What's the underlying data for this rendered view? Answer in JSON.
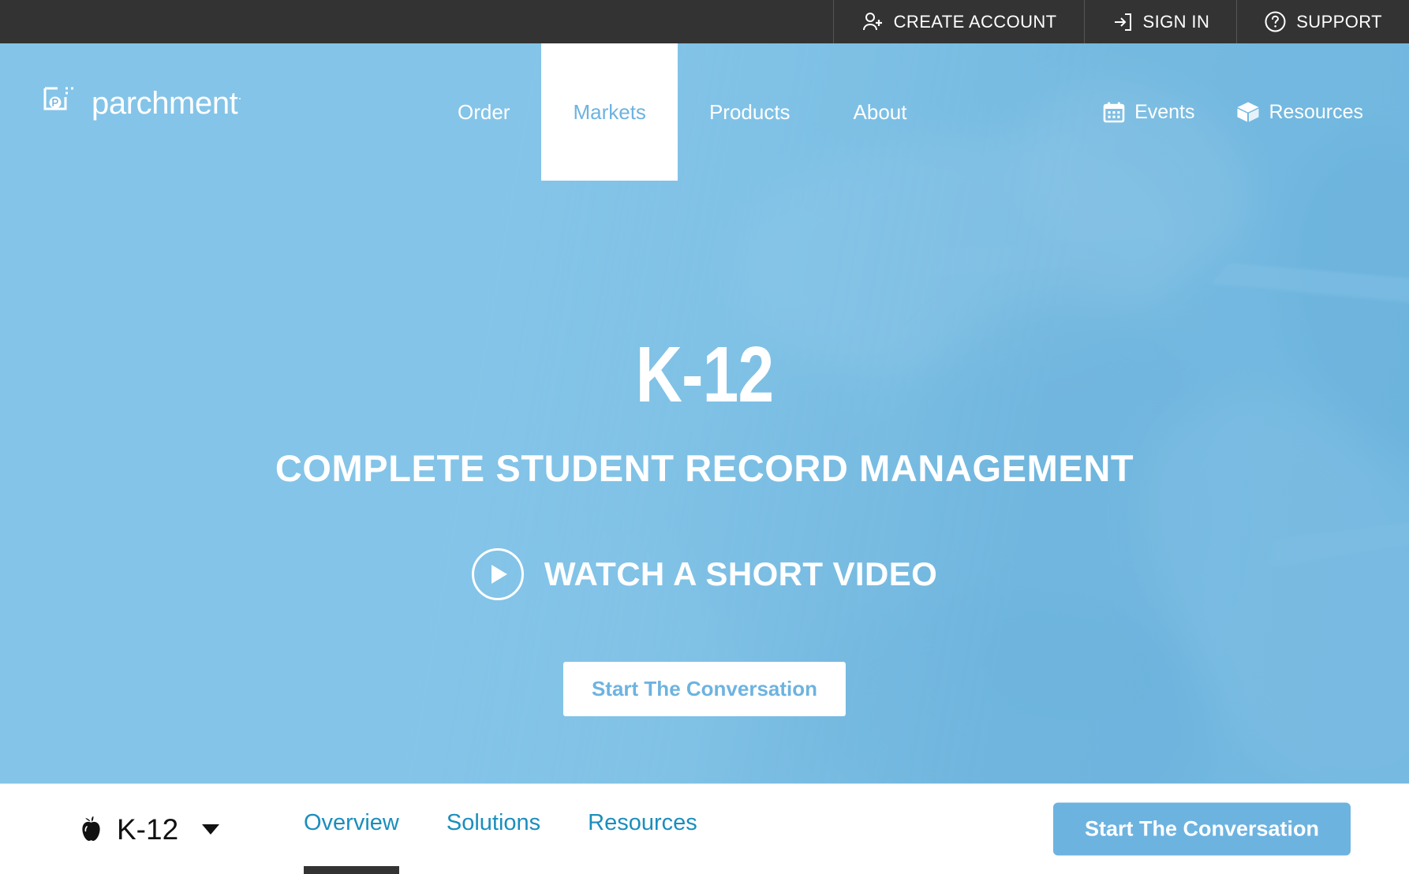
{
  "topbar": {
    "items": [
      {
        "label": "CREATE ACCOUNT",
        "icon": "user-plus-icon"
      },
      {
        "label": "SIGN IN",
        "icon": "sign-in-icon"
      },
      {
        "label": "SUPPORT",
        "icon": "question-circle-icon"
      }
    ]
  },
  "brand": {
    "wordmark": "parchment",
    "trademark": "·",
    "logo_icon": "parchment-logo-icon"
  },
  "mainnav": {
    "items": [
      {
        "label": "Order",
        "active": false
      },
      {
        "label": "Markets",
        "active": true
      },
      {
        "label": "Products",
        "active": false
      },
      {
        "label": "About",
        "active": false
      }
    ],
    "right_items": [
      {
        "label": "Events",
        "icon": "calendar-icon"
      },
      {
        "label": "Resources",
        "icon": "box-icon"
      }
    ]
  },
  "hero": {
    "title": "K-12",
    "subtitle": "COMPLETE STUDENT RECORD MANAGEMENT",
    "video_label": "WATCH A SHORT VIDEO",
    "cta_label": "Start The Conversation"
  },
  "subnav": {
    "brand_label": "K-12",
    "brand_icon": "apple-icon",
    "tabs": [
      {
        "label": "Overview",
        "active": true
      },
      {
        "label": "Solutions",
        "active": false
      },
      {
        "label": "Resources",
        "active": false
      }
    ],
    "cta_label": "Start The Conversation"
  },
  "colors": {
    "topbar_bg": "#333333",
    "hero_blue": "#81c2e6",
    "accent_blue": "#6db3e0",
    "tab_teal": "#1a8ebd",
    "white": "#ffffff"
  }
}
